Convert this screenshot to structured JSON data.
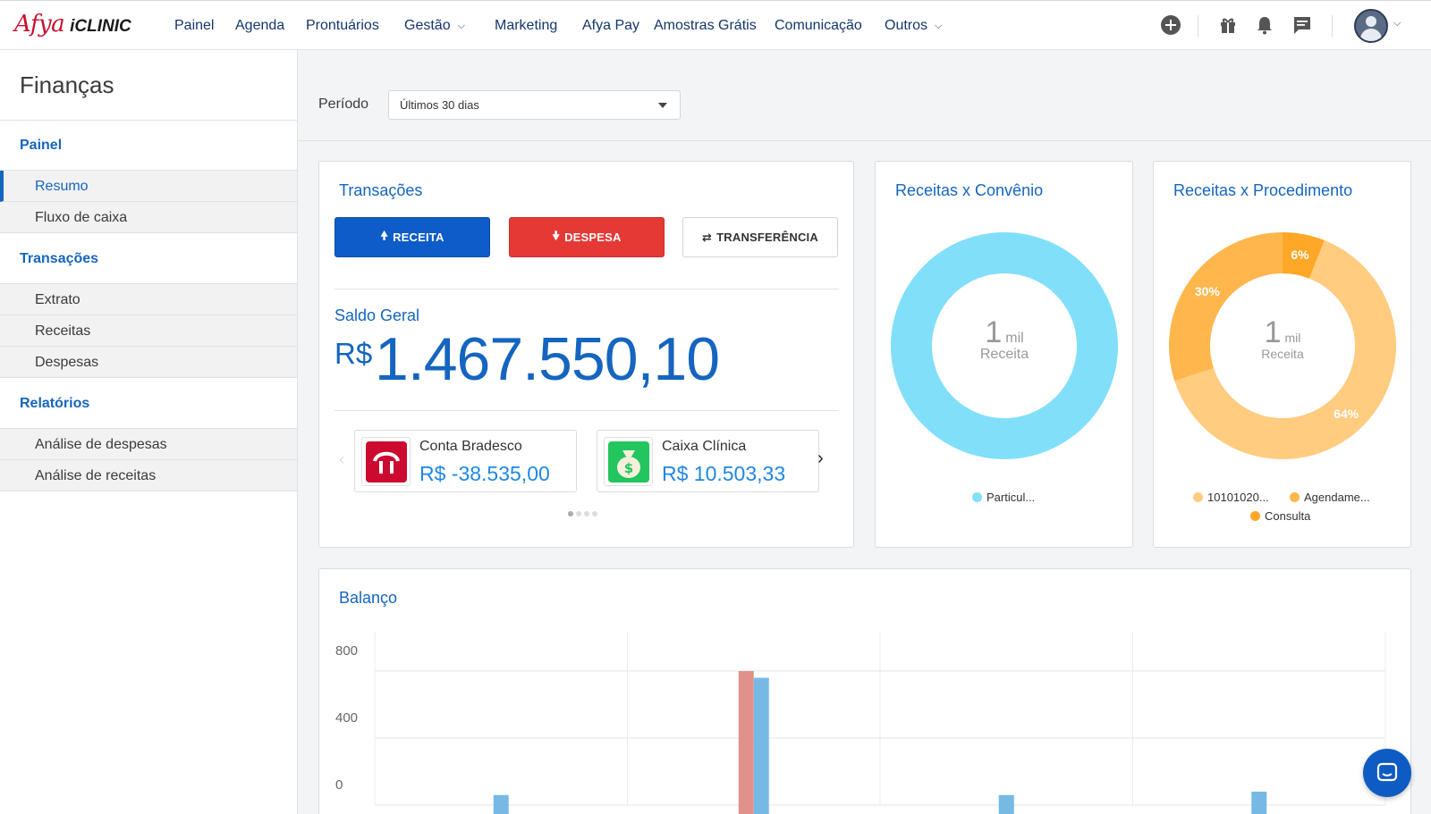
{
  "logo": {
    "afya": "Afya",
    "iclinic": "iCLINIC"
  },
  "nav": {
    "items": [
      "Painel",
      "Agenda",
      "Prontuários",
      "Gestão",
      "Marketing",
      "Afya Pay",
      "Amostras Grátis",
      "Comunicação",
      "Outros"
    ]
  },
  "sidebar": {
    "title": "Finanças",
    "sections": [
      {
        "heading": "Painel",
        "items": [
          "Resumo",
          "Fluxo de caixa"
        ]
      },
      {
        "heading": "Transações",
        "items": [
          "Extrato",
          "Receitas",
          "Despesas"
        ]
      },
      {
        "heading": "Relatórios",
        "items": [
          "Análise de despesas",
          "Análise de receitas"
        ]
      }
    ]
  },
  "filter": {
    "label": "Período",
    "value": "Últimos 30 dias"
  },
  "transacoes": {
    "title": "Transações",
    "buttons": {
      "receita": "RECEITA",
      "despesa": "DESPESA",
      "transferencia": "TRANSFERÊNCIA"
    },
    "saldo_label": "Saldo Geral",
    "saldo_currency": "R$",
    "saldo_value": "1.467.550,10",
    "accounts": [
      {
        "name": "Conta Bradesco",
        "value": "R$ -38.535,00"
      },
      {
        "name": "Caixa Clínica",
        "value": "R$ 10.503,33"
      }
    ]
  },
  "convenio": {
    "title": "Receitas x Convênio",
    "center_number": "1",
    "center_unit": "mil",
    "center_label": "Receita",
    "legend": [
      "Particul..."
    ],
    "color": "#81dffa"
  },
  "procedimento": {
    "title": "Receitas x Procedimento",
    "center_number": "1",
    "center_unit": "mil",
    "center_label": "Receita",
    "legend": [
      "10101020...",
      "Agendame...",
      "Consulta"
    ],
    "colors": [
      "#ffcc80",
      "#ffb74d",
      "#ffa726"
    ],
    "slices": [
      {
        "label": "64%",
        "value": 64
      },
      {
        "label": "30%",
        "value": 30
      },
      {
        "label": "6%",
        "value": 6
      }
    ]
  },
  "balanco": {
    "title": "Balanço"
  },
  "chart_data": {
    "type": "bar",
    "ylim": [
      0,
      800
    ],
    "yticks": [
      "800",
      "400",
      "0"
    ],
    "series": [
      {
        "color": "#e0928a",
        "values": [
          0,
          800,
          0,
          0
        ]
      },
      {
        "color": "#76b9e5",
        "values": [
          60,
          760,
          60,
          80
        ]
      }
    ]
  }
}
